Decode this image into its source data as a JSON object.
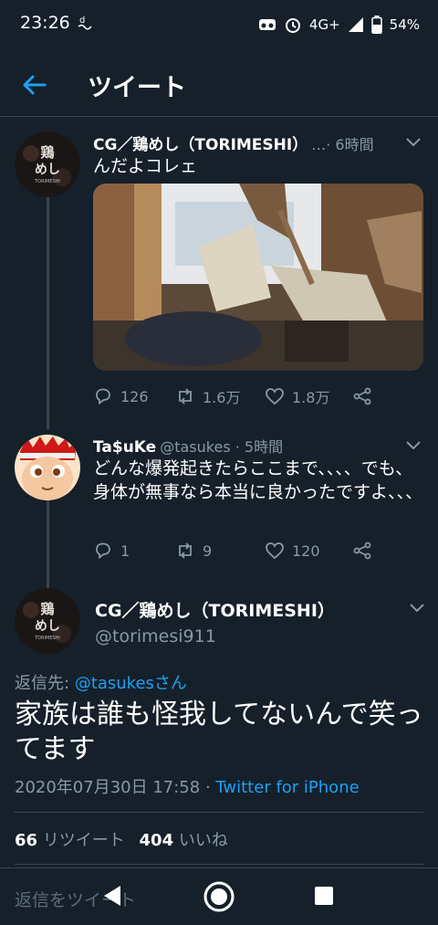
{
  "status_bar": {
    "time": "23:26",
    "network": "4G+",
    "battery": "54%",
    "icons": [
      "notification-app-icon",
      "vr-icon",
      "alarm-icon",
      "signal-icon",
      "battery-icon"
    ]
  },
  "header": {
    "title": "ツイート"
  },
  "tweet1": {
    "name": "CG／鶏めし（TORIMESHI）",
    "meta": "…· 6時間",
    "text": "んだよコレェ",
    "avatar_text": "鶏めし",
    "avatar_sub": "TORIMESHI",
    "replies": "126",
    "retweets": "1.6万",
    "likes": "1.8万"
  },
  "tweet2": {
    "name": "Ta$uKe",
    "handle_time": "@tasukes · 5時間",
    "text": "どんな爆発起きたらここまで、、、、でも、身体が無事なら本当に良かったですよ、、、",
    "replies": "1",
    "retweets": "9",
    "likes": "120"
  },
  "main_tweet": {
    "name": "CG／鶏めし（TORIMESHI）",
    "handle": "@torimesi911",
    "avatar_text": "鶏めし",
    "avatar_sub": "TORIMESHI",
    "reply_to_label": "返信先:",
    "reply_to_handle": "@tasukesさん",
    "text": "家族は誰も怪我してないんで笑ってます",
    "date": "2020年07月30日 17:58",
    "sep": " · ",
    "source": "Twitter for iPhone",
    "retweet_count": "66",
    "retweet_label": "リツイート",
    "like_count": "404",
    "like_label": "いいね"
  },
  "reply_bar": {
    "placeholder": "返信をツイート"
  },
  "colors": {
    "background": "#15202b",
    "accent": "#1da1f2",
    "muted": "#8899a6",
    "border": "#38444d"
  }
}
